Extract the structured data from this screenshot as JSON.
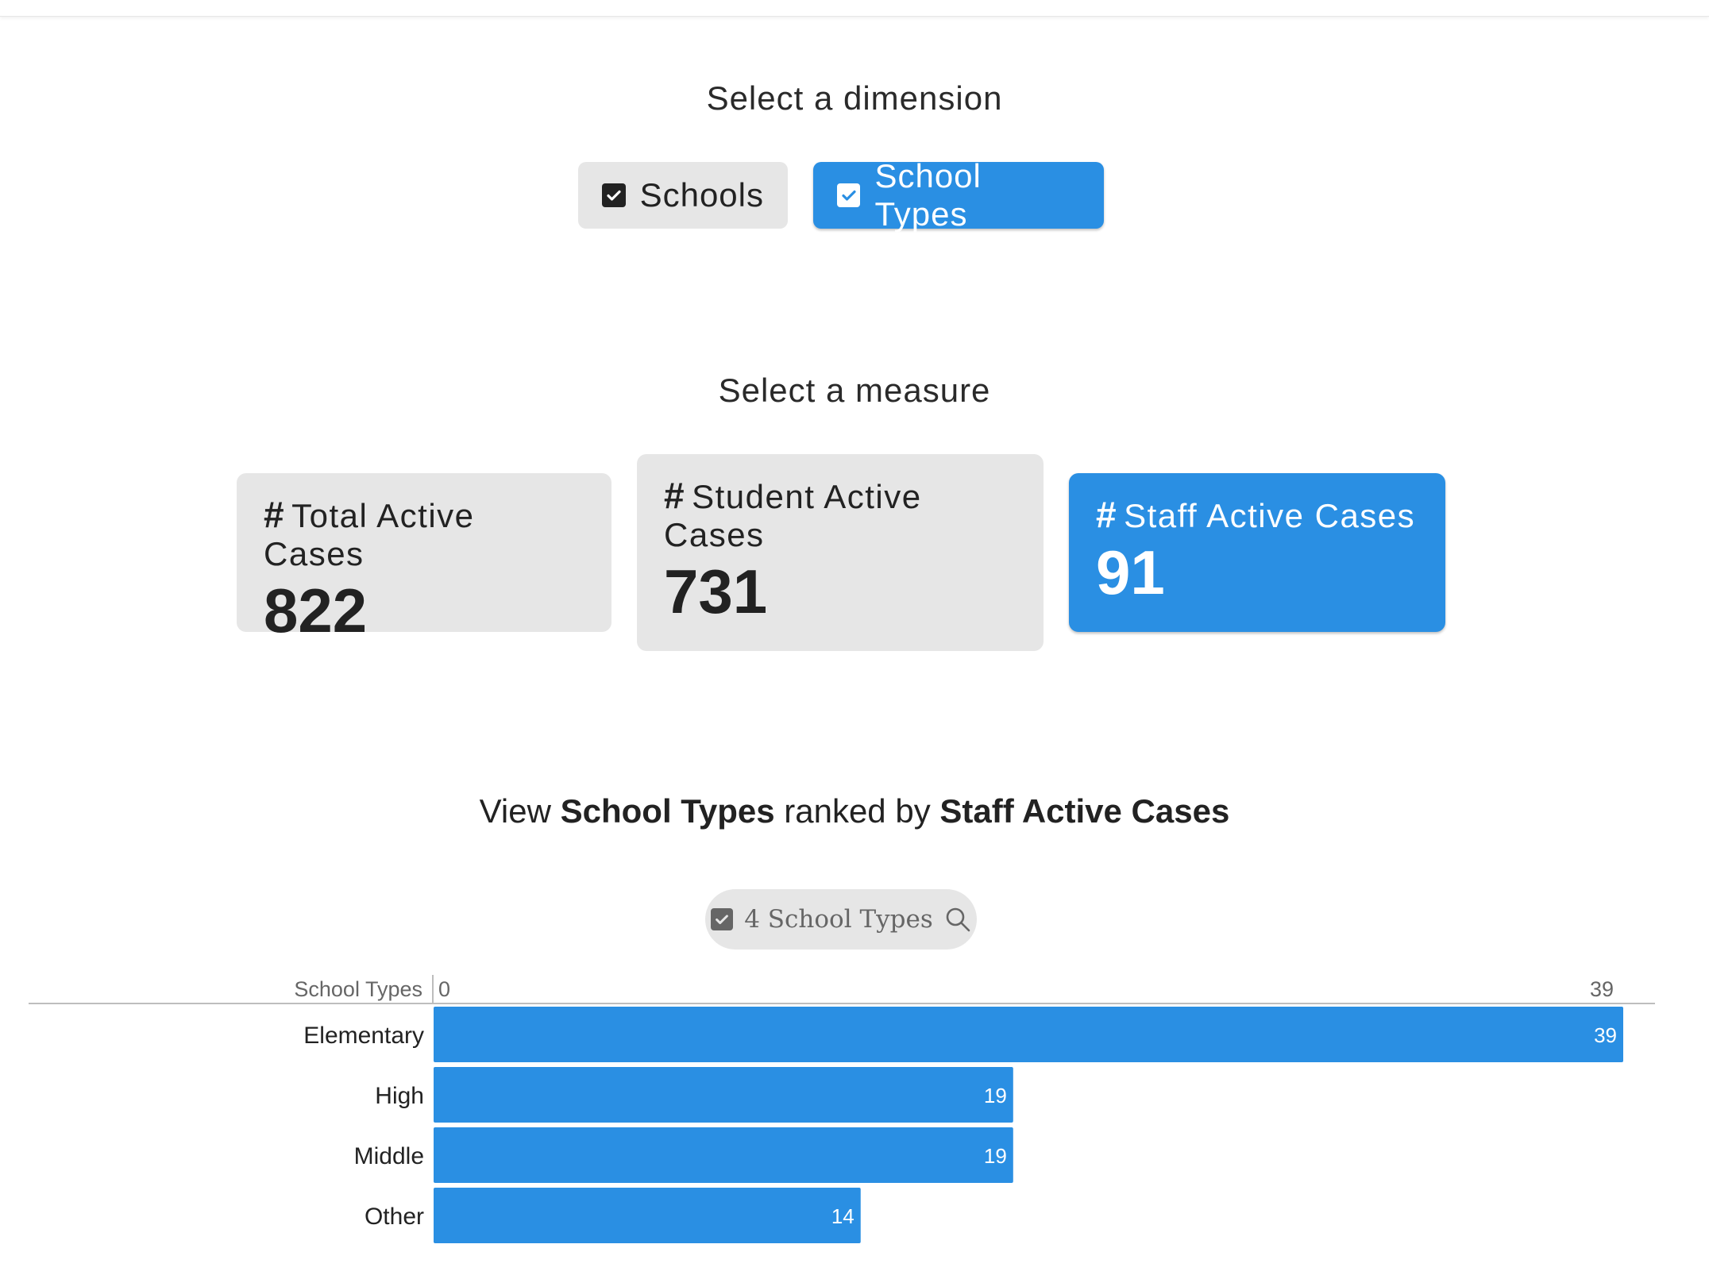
{
  "dimension": {
    "title": "Select a dimension",
    "options": [
      {
        "label": "Schools",
        "selected": false
      },
      {
        "label": "School Types",
        "selected": true
      }
    ]
  },
  "measure": {
    "title": "Select a measure",
    "cards": [
      {
        "hash": "#",
        "label": "Total Active Cases",
        "value": "822",
        "selected": false
      },
      {
        "hash": "#",
        "label": "Student Active Cases",
        "value": "731",
        "selected": false
      },
      {
        "hash": "#",
        "label": "Staff Active Cases",
        "value": "91",
        "selected": true
      }
    ]
  },
  "ranked": {
    "prefix": "View",
    "dimension": "School Types",
    "middle": "ranked by",
    "measure": "Staff Active Cases"
  },
  "filter": {
    "label": "4 School Types"
  },
  "colors": {
    "accent": "#2a8fe3",
    "inactive": "#e6e6e6"
  },
  "chart_data": {
    "type": "bar",
    "orientation": "horizontal",
    "category_header": "School Types",
    "axis_min_label": "0",
    "axis_max_label": "39",
    "xlim": [
      0,
      39
    ],
    "categories": [
      "Elementary",
      "High",
      "Middle",
      "Other"
    ],
    "values": [
      39,
      19,
      19,
      14
    ],
    "bar_color": "#2a8fe3"
  }
}
